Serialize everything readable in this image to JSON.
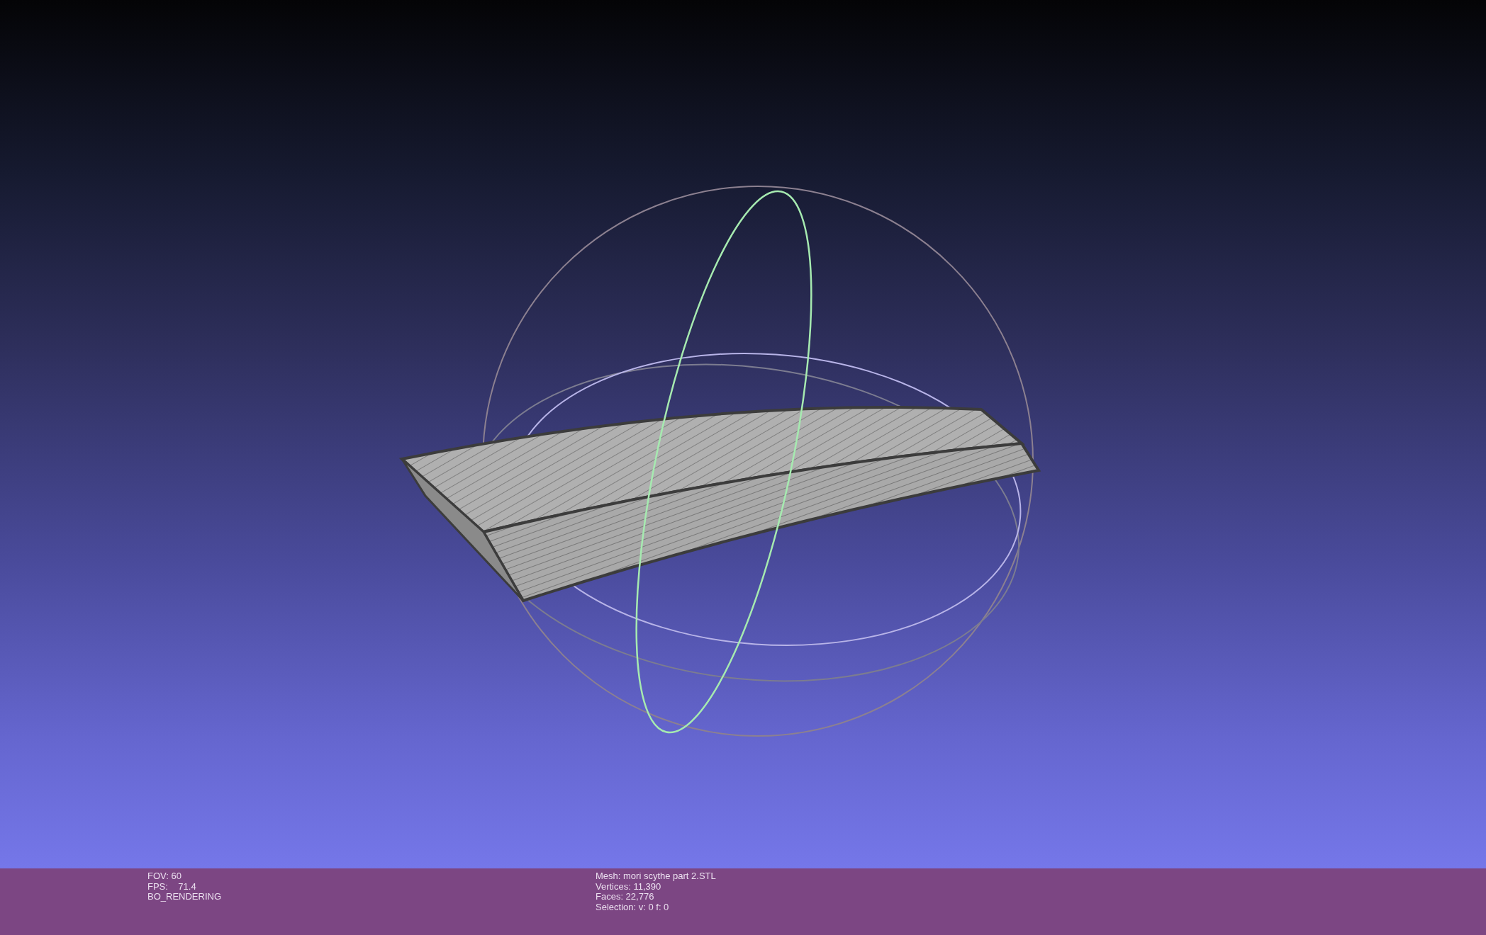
{
  "status_bar": {
    "left": [
      "FOV: 60",
      "FPS:    71.4",
      "BO_RENDERING"
    ],
    "right": [
      "Mesh: mori scythe part 2.STL",
      "Vertices: 11,390",
      "Faces: 22,776",
      "Selection: v: 0 f: 0"
    ]
  }
}
